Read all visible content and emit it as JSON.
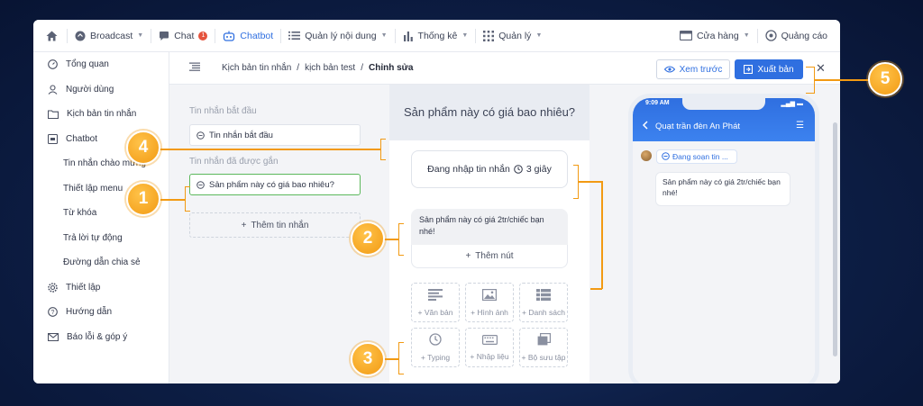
{
  "nav": {
    "items": [
      {
        "label": "Broadcast",
        "icon": "broadcast-icon",
        "caret": true
      },
      {
        "label": "Chat",
        "icon": "chat-icon",
        "badge": "1"
      },
      {
        "label": "Chatbot",
        "icon": "chatbot-icon",
        "active": true
      },
      {
        "label": "Quản lý nội dung",
        "icon": "list-icon",
        "caret": true
      },
      {
        "label": "Thống kê",
        "icon": "chart-icon",
        "caret": true
      },
      {
        "label": "Quản lý",
        "icon": "grid-icon",
        "caret": true
      }
    ],
    "right": [
      {
        "label": "Cửa hàng",
        "icon": "store-icon",
        "caret": true
      },
      {
        "label": "Quảng cáo",
        "icon": "ads-icon"
      }
    ]
  },
  "sidebar": {
    "items": [
      {
        "label": "Tổng quan",
        "icon": "dashboard-icon"
      },
      {
        "label": "Người dùng",
        "icon": "user-icon"
      },
      {
        "label": "Kịch bản tin nhắn",
        "icon": "folder-icon"
      },
      {
        "label": "Chatbot",
        "icon": "bot-icon"
      }
    ],
    "subitems": [
      "Tin nhắn chào mừng",
      "Thiết lập menu",
      "Từ khóa",
      "Trả lời tự động",
      "Đường dẫn chia sẻ"
    ],
    "bottom": [
      {
        "label": "Thiết lập",
        "icon": "gear-icon"
      },
      {
        "label": "Hướng dẫn",
        "icon": "help-icon"
      },
      {
        "label": "Báo lỗi & góp ý",
        "icon": "mail-icon"
      }
    ]
  },
  "breadcrumb": {
    "items": [
      "Kịch bản tin nhắn",
      "kịch bản test"
    ],
    "current": "Chỉnh sửa",
    "separator": "/"
  },
  "actions": {
    "preview": "Xem trước",
    "publish": "Xuất bản"
  },
  "messages": {
    "start_label": "Tin nhắn bắt đầu",
    "start_value": "Tin nhắn bắt đầu",
    "attached_label": "Tin nhắn đã được gắn",
    "attached_value": "Sản phẩm này có giá bao nhiêu?",
    "add_label": "Thêm tin nhắn"
  },
  "editor": {
    "title": "Sản phẩm này có giá bao nhiêu?",
    "typing": "Đang nhập tin nhắn",
    "typing_duration": "3 giây",
    "text_block": "Sản phẩm này có giá 2tr/chiếc bạn nhé!",
    "add_button": "Thêm nút",
    "tiles": [
      {
        "label": "+ Văn bản",
        "icon": "text-icon"
      },
      {
        "label": "+ Hình ảnh",
        "icon": "image-icon"
      },
      {
        "label": "+ Danh sách",
        "icon": "list-icon"
      },
      {
        "label": "+ Typing",
        "icon": "clock-icon"
      },
      {
        "label": "+ Nhập liệu",
        "icon": "keyboard-icon"
      },
      {
        "label": "+ Bộ sưu tập",
        "icon": "gallery-icon"
      }
    ]
  },
  "phone": {
    "time": "9:09 AM",
    "contact": "Quạt trần đèn An Phát",
    "typing": "Đang soạn tin ...",
    "reply": "Sản phẩm này có giá 2tr/chiếc bạn nhé!"
  },
  "callouts": [
    "1",
    "2",
    "3",
    "4",
    "5"
  ],
  "colors": {
    "accent": "#2f6fe0",
    "callout": "#f29a13",
    "selected_border": "#5cb85c"
  }
}
